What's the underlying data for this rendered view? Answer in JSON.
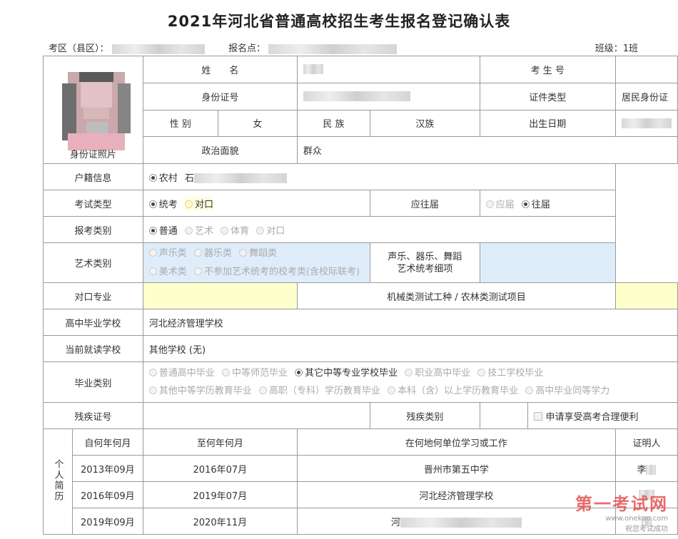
{
  "page_title": "2021年河北省普通高校招生考生报名登记确认表",
  "header": {
    "exam_area_label": "考区（县区）：",
    "exam_area_value": "",
    "site_label": "报名点：",
    "site_value": "",
    "class_label": "班级：",
    "class_value": "1班"
  },
  "photo": {
    "label": "身份证照片"
  },
  "identity": {
    "name_label": "姓　　名",
    "name_value": "",
    "exam_no_label": "考 生 号",
    "exam_no_value": "",
    "id_label": "身份证号",
    "id_value": "",
    "cert_type_label": "证件类型",
    "cert_type_value": "居民身份证",
    "gender_label": "性 别",
    "gender_value": "女",
    "ethnicity_label": "民 族",
    "ethnicity_value": "汉族",
    "birth_label": "出生日期",
    "birth_value": "",
    "political_label": "政治面貌",
    "political_value": "群众",
    "hukou_label": "户籍信息",
    "hukou_option": "农村",
    "hukou_addr": "石"
  },
  "exam_type": {
    "label": "考试类型",
    "options": [
      "统考",
      "对口"
    ],
    "grad_label": "应往届",
    "grad_options": [
      "应届",
      "往届"
    ]
  },
  "category": {
    "label": "报考类别",
    "options": [
      "普通",
      "艺术",
      "体育",
      "对口"
    ]
  },
  "art": {
    "label": "艺术类别",
    "row1": [
      "声乐类",
      "器乐类",
      "舞蹈类"
    ],
    "row2": [
      "美术类",
      "不参加艺术统考的校考类(含校际联考)"
    ],
    "detail_label_1": "声乐、器乐、舞蹈",
    "detail_label_2": "艺术统考细项"
  },
  "vocational": {
    "label": "对口专业",
    "test_label": "机械类测试工种 / 农林类测试项目"
  },
  "school": {
    "hs_label": "高中毕业学校",
    "hs_value": "河北经济管理学校",
    "cur_label": "当前就读学校",
    "cur_value": "其他学校 (无)"
  },
  "grad_type": {
    "label": "毕业类别",
    "row1": [
      "普通高中毕业",
      "中等师范毕业",
      "其它中等专业学校毕业",
      "职业高中毕业",
      "技工学校毕业"
    ],
    "row2": [
      "其他中等学历教育毕业",
      "高职（专科）学历教育毕业",
      "本科（含）以上学历教育毕业",
      "高中毕业同等学力"
    ]
  },
  "disability": {
    "cert_label": "残疾证号",
    "type_label": "残疾类别",
    "apply_label": "申请享受高考合理便利"
  },
  "resume": {
    "label": "个人简历",
    "headers": [
      "自何年何月",
      "至何年何月",
      "在何地何单位学习或工作",
      "证明人"
    ],
    "rows": [
      [
        "2013年09月",
        "2016年07月",
        "晋州市第五中学",
        "李"
      ],
      [
        "2016年09月",
        "2019年07月",
        "河北经济管理学校",
        ""
      ],
      [
        "2019年09月",
        "2020年11月",
        "河",
        ""
      ]
    ]
  },
  "watermark": {
    "brand": "第一考试网",
    "url": "www.onekao.com",
    "slogan": "祝您考试成功"
  },
  "colors": {
    "art_bg": "#dfedfb",
    "vocational_bg": "#ffffcc",
    "border": "#9a9a9a",
    "watermark": "#e23b3b"
  }
}
